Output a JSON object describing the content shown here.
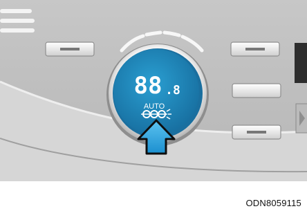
{
  "figure": {
    "caption_code": "ODN8059115"
  },
  "display": {
    "temperature": "88",
    "temperature_decimal": ".8",
    "mode_label": "AUTO",
    "fan_icon": "fan-speed-icon"
  },
  "indicator": {
    "arrow_icon": "up-arrow-icon"
  },
  "colors": {
    "panel_gray": "#bfbfbf",
    "panel_light": "#dcdcdc",
    "display_blue": "#1d86b8",
    "display_text": "#ffffff",
    "arrow_blue": "#2aa0dc"
  }
}
